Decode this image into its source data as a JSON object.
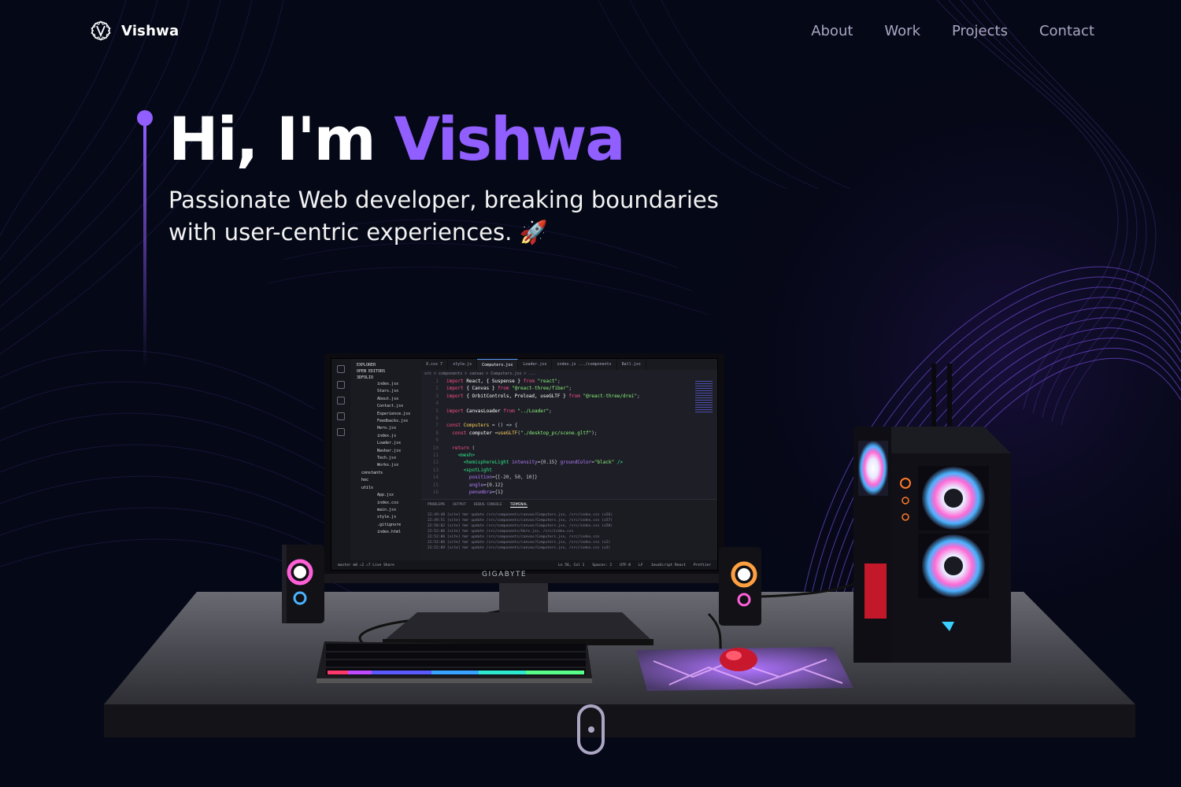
{
  "theme": {
    "background": "#050816",
    "accent": "#915eff",
    "nav_text": "#aaa6c3"
  },
  "navbar": {
    "logo_icon": "v-logo-icon",
    "brand": "Vishwa",
    "links": [
      "About",
      "Work",
      "Projects",
      "Contact"
    ]
  },
  "hero": {
    "title_prefix": "Hi, I'm ",
    "title_name": "Vishwa",
    "subtitle_line1": "Passionate Web developer, breaking boundaries",
    "subtitle_line2": "with user-centric experiences. 🚀"
  },
  "editor": {
    "explorer_title": "EXPLORER",
    "open_editors": "OPEN EDITORS",
    "project": "3DFOLIO",
    "files": [
      "index.jsx",
      "Stars.jsx",
      "About.jsx",
      "Contact.jsx",
      "Experience.jsx",
      "Feedbacks.jsx",
      "Hero.jsx",
      "index.js",
      "Loader.jsx",
      "Navbar.jsx",
      "Tech.jsx",
      "Works.jsx"
    ],
    "folders": [
      "constants",
      "hoc",
      "utils"
    ],
    "root_files": [
      "App.jsx",
      "index.css",
      "main.jsx",
      "style.js",
      ".gitignore",
      "index.html"
    ],
    "tabs": [
      "X.css 7",
      "style.js",
      "Computers.jsx",
      "Loader.jsx",
      "index.js .../components",
      "Ball.jsx"
    ],
    "breadcrumb": "src > components > canvas > Computers.jsx > ...",
    "panel_tabs": [
      "PROBLEMS",
      "OUTPUT",
      "DEBUG CONSOLE",
      "TERMINAL"
    ],
    "terminal_lines": [
      "22:49:48 [vite] hmr update /src/components/canvas/Computers.jsx, /src/index.css (x56)",
      "22:49:51 [vite] hmr update /src/components/canvas/Computers.jsx, /src/index.css (x57)",
      "22:50:02 [vite] hmr update /src/components/canvas/Computers.jsx, /src/index.css (x58)",
      "22:52:06 [vite] hmr update /src/components/Hero.jsx, /src/index.css",
      "22:52:06 [vite] hmr update /src/components/canvas/Computers.jsx, /src/index.css",
      "22:52:06 [vite] hmr update /src/components/canvas/Computers.jsx, /src/index.css (x2)",
      "22:52:09 [vite] hmr update /src/components/canvas/Computers.jsx, /src/index.css (x3)"
    ],
    "status_left": "master  ⊗0 ⚠2  ⚠7  Live Share",
    "status_right": [
      "Ln 56, Col 1",
      "Spaces: 2",
      "UTF-8",
      "LF",
      "JavaScript React",
      "Prettier"
    ]
  },
  "monitor_brand": "GIGABYTE",
  "scroll_indicator_icon": "mouse-scroll-icon"
}
